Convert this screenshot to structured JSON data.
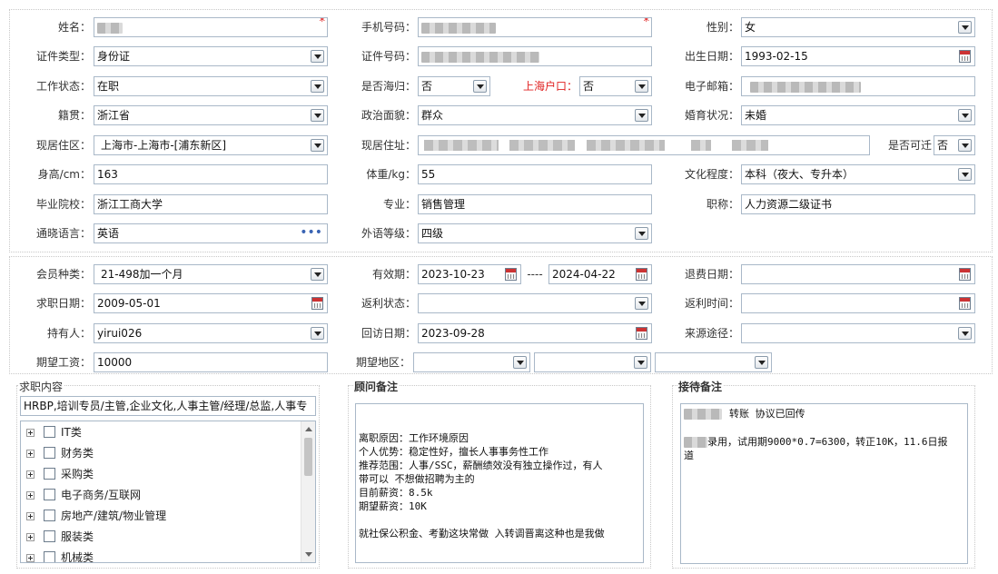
{
  "basic": {
    "name": {
      "label": "姓名：",
      "value": ""
    },
    "phone": {
      "label": "手机号码：",
      "value": ""
    },
    "gender": {
      "label": "性别：",
      "value": "女"
    },
    "id_type": {
      "label": "证件类型：",
      "value": "身份证"
    },
    "id_number": {
      "label": "证件号码：",
      "value": ""
    },
    "birth_date": {
      "label": "出生日期：",
      "value": "1993-02-15"
    },
    "work_status": {
      "label": "工作状态：",
      "value": "在职"
    },
    "returnee": {
      "label": "是否海归：",
      "value": "否"
    },
    "shanghai_hukou": {
      "label": "上海户口：",
      "value": "否"
    },
    "email": {
      "label": "电子邮箱：",
      "value": ""
    },
    "native_place": {
      "label": "籍贯：",
      "value": "浙江省"
    },
    "political": {
      "label": "政治面貌：",
      "value": "群众"
    },
    "marital": {
      "label": "婚育状况：",
      "value": "未婚"
    },
    "residence_area": {
      "label": "现居住区：",
      "value": "上海市-上海市-[浦东新区]"
    },
    "residence_address": {
      "label": "现居住址：",
      "value": ""
    },
    "relocate": {
      "label": "是否可迁",
      "value": "否"
    },
    "height": {
      "label": "身高/cm：",
      "value": "163"
    },
    "weight": {
      "label": "体重/kg：",
      "value": "55"
    },
    "education": {
      "label": "文化程度：",
      "value": "本科（夜大、专升本）"
    },
    "school": {
      "label": "毕业院校：",
      "value": "浙江工商大学"
    },
    "major": {
      "label": "专业：",
      "value": "销售管理"
    },
    "title": {
      "label": "职称：",
      "value": "人力资源二级证书"
    },
    "language": {
      "label": "通晓语言：",
      "value": "英语"
    },
    "language_level": {
      "label": "外语等级：",
      "value": "四级"
    }
  },
  "membership": {
    "member_type": {
      "label": "会员种类：",
      "value": "21-498加一个月"
    },
    "validity": {
      "label": "有效期：",
      "start": "2023-10-23",
      "sep": "----",
      "end": "2024-04-22"
    },
    "refund_date": {
      "label": "退费日期：",
      "value": ""
    },
    "job_seek_date": {
      "label": "求职日期：",
      "value": "2009-05-01"
    },
    "rebate_status": {
      "label": "返利状态：",
      "value": ""
    },
    "rebate_time": {
      "label": "返利时间：",
      "value": ""
    },
    "holder": {
      "label": "持有人：",
      "value": "yirui026"
    },
    "visit_date": {
      "label": "回访日期：",
      "value": "2023-09-28"
    },
    "source": {
      "label": "来源途径：",
      "value": ""
    },
    "expected_salary": {
      "label": "期望工资：",
      "value": "10000"
    },
    "expected_region": {
      "label": "期望地区：",
      "value1": "",
      "value2": "",
      "value3": ""
    }
  },
  "job_content": {
    "header": "求职内容",
    "summary": "HRBP,培训专员/主管,企业文化,人事主管/经理/总监,人事专",
    "categories": [
      "IT类",
      "财务类",
      "采购类",
      "电子商务/互联网",
      "房地产/建筑/物业管理",
      "服装类",
      "机械类"
    ]
  },
  "consultant_notes": {
    "header": "顾问备注",
    "lines": [
      "离职原因：工作环境原因",
      "个人优势：稳定性好，擅长人事事务性工作",
      "推荐范围：人事/SSC，薪酬绩效没有独立操作过，有人",
      "带可以   不想做招聘为主的",
      "目前薪资：8.5k",
      "期望薪资：10K",
      "",
      "就社保公积金、考勤这块常做 入转调晋离这种也是我做"
    ]
  },
  "reception_notes": {
    "header": "接待备注",
    "line1": "转账 协议已回传",
    "line2a": "录用，试用期9000*0.7=6300，转正10K，11.6日报",
    "line2b": "道"
  },
  "colors": {
    "border": "#a9b8c8",
    "required": "#e02020",
    "label": "#333333"
  }
}
